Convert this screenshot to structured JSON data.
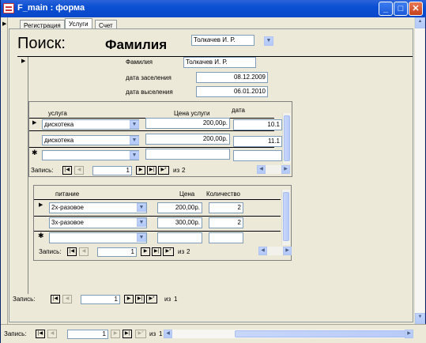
{
  "window": {
    "title": "F_main : форма",
    "btn_min": "_",
    "btn_max": "□",
    "btn_close": "✕"
  },
  "tabs": [
    {
      "label": "Регистрация"
    },
    {
      "label": "Услуги"
    },
    {
      "label": "Счет"
    }
  ],
  "search": {
    "label": "Поиск:",
    "field_label": "Фамилия",
    "value": "Толкачев И. Р."
  },
  "record": {
    "surname_label": "Фамилия",
    "surname_value": "Толкачев И. Р.",
    "checkin_label": "дата заселения",
    "checkin_value": "08.12.2009",
    "checkout_label": "дата выселения",
    "checkout_value": "06.01.2010"
  },
  "services": {
    "columns": {
      "service": "услуга",
      "price": "Цена услуги",
      "date": "дата"
    },
    "rows": [
      {
        "service": "дискотека",
        "price": "200,00р.",
        "date": "10.1"
      },
      {
        "service": "дискотека",
        "price": "200,00р.",
        "date": "11.1"
      }
    ],
    "nav": {
      "label": "Запись:",
      "current": "1",
      "of": "из",
      "total": "2"
    }
  },
  "meals": {
    "columns": {
      "meal": "питание",
      "price": "Цена",
      "qty": "Количество"
    },
    "rows": [
      {
        "meal": "2х-разовое",
        "price": "200,00р.",
        "qty": "2"
      },
      {
        "meal": "3х-разовое",
        "price": "300,00р.",
        "qty": "2"
      }
    ],
    "nav": {
      "label": "Запись:",
      "current": "1",
      "of": "из",
      "total": "2"
    }
  },
  "tab_nav": {
    "label": "Запись:",
    "current": "1",
    "of": "из",
    "total": "1"
  },
  "form_nav": {
    "label": "Запись:",
    "current": "1",
    "of": "из",
    "total": "1"
  },
  "glyphs": {
    "first": "|◀",
    "prev": "◀",
    "next": "▶",
    "last": "▶|",
    "new": "▶*",
    "down": "▼",
    "up": "▲",
    "left": "◀",
    "right": "▶",
    "selector": "▶",
    "new_row": "✱"
  }
}
